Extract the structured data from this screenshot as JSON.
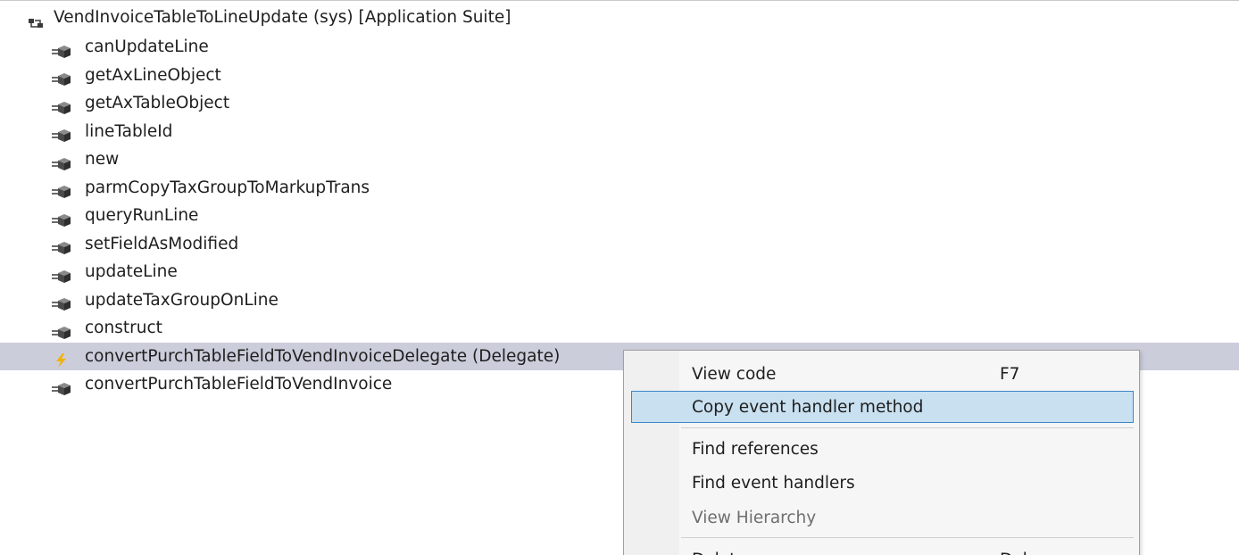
{
  "tree": {
    "root": {
      "label": "VendInvoiceTableToLineUpdate (sys) [Application Suite]",
      "icon": "class-hierarchy-icon"
    },
    "children": [
      {
        "label": "canUpdateLine",
        "icon": "method-icon"
      },
      {
        "label": "getAxLineObject",
        "icon": "method-icon"
      },
      {
        "label": "getAxTableObject",
        "icon": "method-icon"
      },
      {
        "label": "lineTableId",
        "icon": "method-icon"
      },
      {
        "label": "new",
        "icon": "method-icon"
      },
      {
        "label": "parmCopyTaxGroupToMarkupTrans",
        "icon": "method-icon"
      },
      {
        "label": "queryRunLine",
        "icon": "method-icon"
      },
      {
        "label": "setFieldAsModified",
        "icon": "method-icon"
      },
      {
        "label": "updateLine",
        "icon": "method-icon"
      },
      {
        "label": "updateTaxGroupOnLine",
        "icon": "method-icon"
      },
      {
        "label": "construct",
        "icon": "method-icon"
      },
      {
        "label": "convertPurchTableFieldToVendInvoiceDelegate (Delegate)",
        "icon": "delegate-icon",
        "selected": true
      },
      {
        "label": "convertPurchTableFieldToVendInvoice",
        "icon": "method-icon"
      }
    ]
  },
  "context_menu": {
    "items": [
      {
        "label": "View code",
        "shortcut": "F7"
      },
      {
        "label": "Copy event handler method",
        "highlighted": true
      },
      {
        "label": "Find references"
      },
      {
        "label": "Find event handlers"
      },
      {
        "label": "View Hierarchy",
        "disabled": true
      },
      {
        "label": "Delete",
        "shortcut": "Del"
      }
    ]
  },
  "colors": {
    "selected_row": "#cbcddb",
    "menu_highlight": "#c9e0f0",
    "menu_highlight_border": "#3c87c8",
    "delegate_bolt": "#f2b100"
  }
}
